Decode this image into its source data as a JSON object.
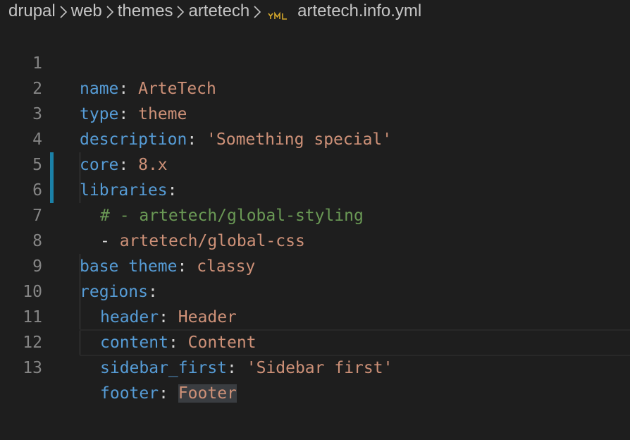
{
  "breadcrumb": {
    "items": [
      "drupal",
      "web",
      "themes",
      "artetech"
    ],
    "file_icon": "yml-file-icon",
    "file_name": "artetech.info.yml"
  },
  "colors": {
    "background": "#1e1e1e",
    "key": "#569cd6",
    "string": "#ce9178",
    "comment": "#6a9955",
    "line_number": "#858585",
    "modified_marker": "#1b81a8"
  },
  "code": {
    "line_numbers": [
      "1",
      "2",
      "3",
      "4",
      "5",
      "6",
      "7",
      "8",
      "9",
      "10",
      "11",
      "12",
      "13"
    ],
    "lines": [
      {
        "key": "name",
        "colon": ":",
        "value": " ArteTech"
      },
      {
        "key": "type",
        "colon": ":",
        "value": " theme"
      },
      {
        "key": "description",
        "colon": ":",
        "value": " 'Something special'"
      },
      {
        "key": "core",
        "colon": ":",
        "value": " 8.x"
      },
      {
        "key": "libraries",
        "colon": ":",
        "value": ""
      },
      {
        "comment": "# - artetech/global-styling"
      },
      {
        "dash": "- ",
        "value": "artetech/global-css"
      },
      {
        "key": "base theme",
        "colon": ":",
        "value": " classy"
      },
      {
        "key": "regions",
        "colon": ":",
        "value": ""
      },
      {
        "key": "header",
        "colon": ":",
        "value": " Header"
      },
      {
        "key": "content",
        "colon": ":",
        "value": " Content"
      },
      {
        "key": "sidebar_first",
        "colon": ":",
        "value": " 'Sidebar first'"
      },
      {
        "key": "footer",
        "colon": ":",
        "value": " ",
        "selected": "Footer"
      }
    ]
  }
}
